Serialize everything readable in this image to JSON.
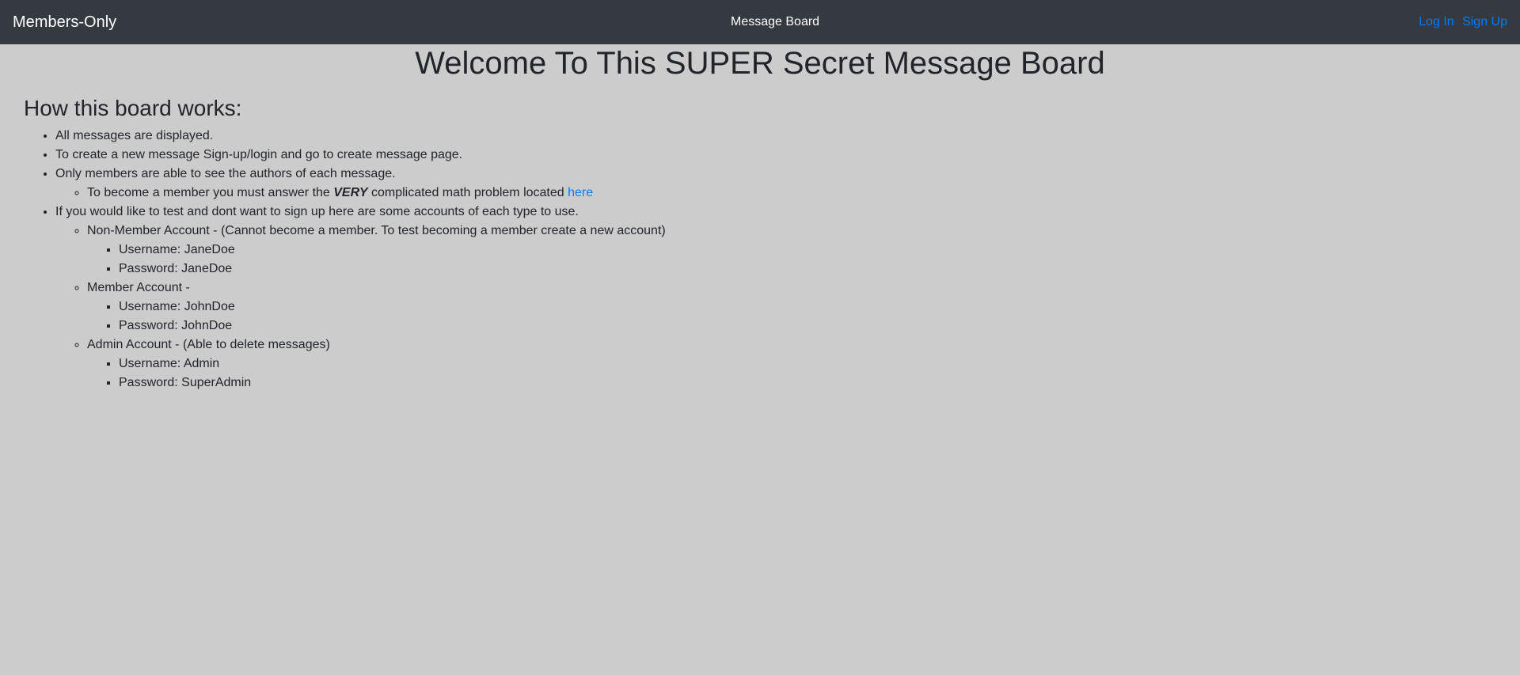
{
  "navbar": {
    "brand": "Members-Only",
    "center_link": "Message Board",
    "login": "Log In",
    "signup": "Sign Up"
  },
  "main": {
    "title": "Welcome To This SUPER Secret Message Board",
    "section_title": "How this board works:",
    "items": [
      "All messages are displayed.",
      "To create a new message Sign-up/login and go to create message page.",
      "Only members are able to see the authors of each message.",
      "If you would like to test and dont want to sign up here are some accounts of each type to use."
    ],
    "member_hint": {
      "prefix": "To become a member you must answer the ",
      "emphasis": "VERY",
      "suffix": " complicated math problem located ",
      "link": "here"
    },
    "accounts": {
      "non_member": {
        "label": "Non-Member Account - (Cannot become a member. To test becoming a member create a new account)",
        "username": "Username: JaneDoe",
        "password": "Password: JaneDoe"
      },
      "member": {
        "label": "Member Account -",
        "username": "Username: JohnDoe",
        "password": "Password: JohnDoe"
      },
      "admin": {
        "label": "Admin Account - (Able to delete messages)",
        "username": "Username: Admin",
        "password": "Password: SuperAdmin"
      }
    }
  },
  "colors": {
    "navbar_bg": "#343a40",
    "page_bg": "#cccccc",
    "link": "#007bff",
    "text": "#212529"
  }
}
